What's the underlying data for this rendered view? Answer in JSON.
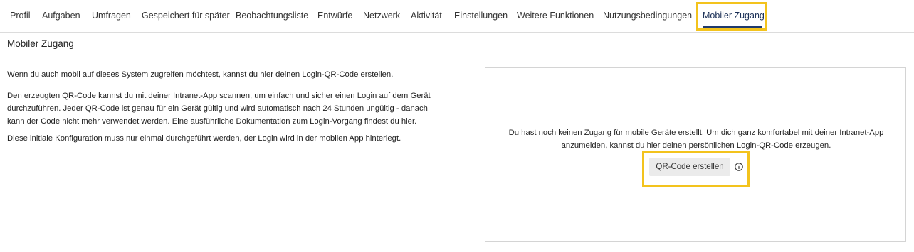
{
  "tabs": [
    {
      "label": "Profil"
    },
    {
      "label": "Aufgaben"
    },
    {
      "label": "Umfragen"
    },
    {
      "label": "Gespeichert für später"
    },
    {
      "label": "Beobachtungsliste"
    },
    {
      "label": "Entwürfe"
    },
    {
      "label": "Netzwerk"
    },
    {
      "label": "Aktivität"
    },
    {
      "label": "Einstellungen"
    },
    {
      "label": "Weitere Funktionen"
    },
    {
      "label": "Nutzungsbedingungen"
    },
    {
      "label": "Mobiler Zugang",
      "active": true
    }
  ],
  "page": {
    "title": "Mobiler Zugang",
    "intro": "Wenn du auch mobil auf dieses System zugreifen möchtest, kannst du hier deinen Login-QR-Code erstellen.",
    "details_lines": [
      "Den erzeugten QR-Code kannst du mit deiner Intranet-App scannen, um einfach und sicher einen Login auf dem Gerät",
      "durchzuführen. Jeder QR-Code ist genau für ein Gerät gültig und wird automatisch nach 24 Stunden ungültig - danach",
      "kann der Code nicht mehr verwendet werden. Eine ausführliche Dokumentation zum Login-Vorgang findest du hier."
    ],
    "note": "Diese initiale Konfiguration muss nur einmal durchgeführt werden, der Login wird in der mobilen App hinterlegt."
  },
  "card": {
    "message_lines": [
      "Du hast noch keinen Zugang für mobile Geräte erstellt. Um dich ganz komfortabel mit deiner Intranet-App",
      "anzumelden, kannst du hier deinen persönlichen Login-QR-Code erzeugen."
    ],
    "button_label": "QR-Code erstellen",
    "info_icon": "info-circle-icon"
  },
  "colors": {
    "highlight": "#f3c31d",
    "active_tab_underline": "#1f3a6e",
    "button_bg": "#ebebeb"
  }
}
